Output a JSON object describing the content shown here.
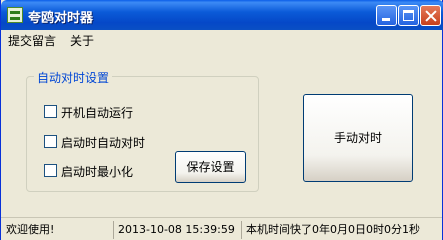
{
  "window": {
    "title": "夸鸥对时器",
    "icon": "clock-app-icon"
  },
  "titlebar_buttons": {
    "minimize_icon": "minimize-icon",
    "maximize_icon": "maximize-icon",
    "close_icon": "close-icon"
  },
  "menu": {
    "items": [
      {
        "label": "提交留言"
      },
      {
        "label": "关于"
      }
    ]
  },
  "auto_sync_group": {
    "title": "自动对时设置",
    "options": [
      {
        "label": "开机自动运行",
        "checked": false
      },
      {
        "label": "启动时自动对时",
        "checked": false
      },
      {
        "label": "启动时最小化",
        "checked": false
      }
    ],
    "save_button": "保存设置"
  },
  "manual_sync_button": "手动对时",
  "statusbar": {
    "welcome": "欢迎使用!",
    "datetime": "2013-10-08 15:39:59",
    "offset": "本机时间快了0年0月0日0时0分1秒"
  },
  "colors": {
    "titlebar_blue": "#0548c8",
    "group_title": "#0046d5",
    "window_bg": "#ece9d8"
  }
}
